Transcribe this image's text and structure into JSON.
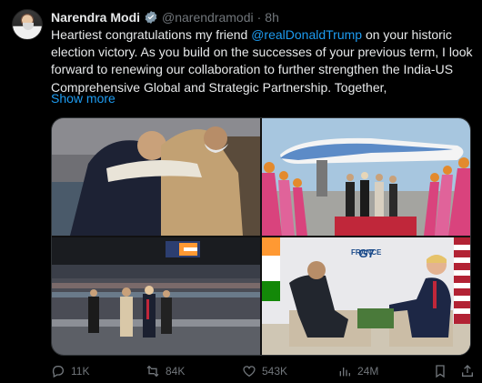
{
  "post": {
    "author_name": "Narendra Modi",
    "handle": "@narendramodi",
    "separator": "·",
    "time": "8h",
    "text_before_mention": "Heartiest congratulations my friend ",
    "mention": "@realDonaldTrump",
    "text_after_mention": " on your historic election victory. As you build on the successes of your previous term, I look forward to renewing our collaboration to further strengthen the India-US Comprehensive Global and Strategic Partnership. Together,",
    "show_more": "Show more"
  },
  "media": {
    "image4_sign_text": "FRANCE"
  },
  "actions": {
    "replies": "11K",
    "reposts": "84K",
    "likes": "543K",
    "views": "24M"
  },
  "colors": {
    "background": "#000000",
    "link": "#1d9bf0",
    "muted": "#71767b",
    "text": "#e7e9ea"
  }
}
